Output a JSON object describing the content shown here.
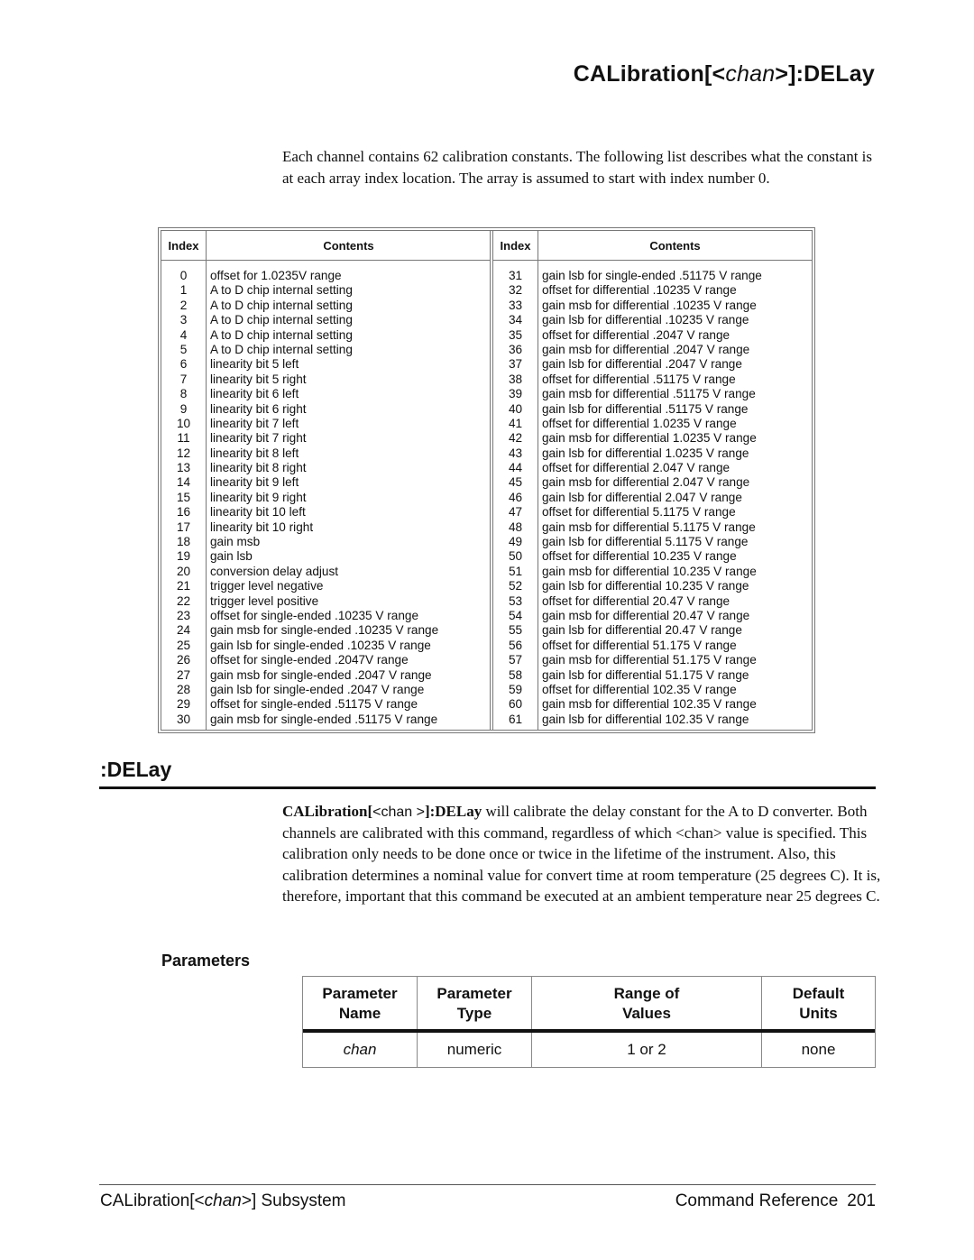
{
  "header": {
    "title_prefix": "CALibration[<",
    "title_italic": "chan",
    "title_suffix": ">]:DELay"
  },
  "intro": "Each channel contains 62 calibration constants.  The following list describes what the constant is at each array index location.  The array is assumed to start with index number 0.",
  "cal_table": {
    "headers": {
      "index": "Index",
      "contents": "Contents"
    },
    "left": [
      {
        "i": "0",
        "c": "offset for 1.0235V range"
      },
      {
        "i": "1",
        "c": "A to D chip internal setting"
      },
      {
        "i": "2",
        "c": "A to D chip internal setting"
      },
      {
        "i": "3",
        "c": "A to D chip internal setting"
      },
      {
        "i": "4",
        "c": "A to D chip internal setting"
      },
      {
        "i": "5",
        "c": "A to D chip internal setting"
      },
      {
        "i": "6",
        "c": "linearity bit 5 left"
      },
      {
        "i": "7",
        "c": "linearity bit 5 right"
      },
      {
        "i": "8",
        "c": "linearity bit 6 left"
      },
      {
        "i": "9",
        "c": "linearity bit 6 right"
      },
      {
        "i": "10",
        "c": "linearity bit 7 left"
      },
      {
        "i": "11",
        "c": "linearity bit 7 right"
      },
      {
        "i": "12",
        "c": "linearity bit 8 left"
      },
      {
        "i": "13",
        "c": "linearity bit 8 right"
      },
      {
        "i": "14",
        "c": "linearity bit 9 left"
      },
      {
        "i": "15",
        "c": "linearity bit 9 right"
      },
      {
        "i": "16",
        "c": "linearity bit 10 left"
      },
      {
        "i": "17",
        "c": "linearity bit 10 right"
      },
      {
        "i": "18",
        "c": "gain msb"
      },
      {
        "i": "19",
        "c": "gain lsb"
      },
      {
        "i": "20",
        "c": "conversion delay adjust"
      },
      {
        "i": "21",
        "c": "trigger level negative"
      },
      {
        "i": "22",
        "c": "trigger level positive"
      },
      {
        "i": "23",
        "c": "offset for single-ended .10235 V range"
      },
      {
        "i": "24",
        "c": "gain msb for single-ended .10235 V range"
      },
      {
        "i": "25",
        "c": "gain lsb for single-ended .10235 V range"
      },
      {
        "i": "26",
        "c": "offset for single-ended .2047V range"
      },
      {
        "i": "27",
        "c": "gain msb for single-ended .2047 V range"
      },
      {
        "i": "28",
        "c": "gain lsb for single-ended .2047 V range"
      },
      {
        "i": "29",
        "c": "offset for single-ended .51175 V range"
      },
      {
        "i": "30",
        "c": "gain msb for single-ended .51175 V range"
      }
    ],
    "right": [
      {
        "i": "31",
        "c": "gain lsb for single-ended .51175 V range"
      },
      {
        "i": "32",
        "c": "offset for differential .10235 V range"
      },
      {
        "i": "33",
        "c": "gain msb for differential .10235 V range"
      },
      {
        "i": "34",
        "c": "gain lsb for differential .10235 V range"
      },
      {
        "i": "35",
        "c": "offset for differential .2047 V range"
      },
      {
        "i": "36",
        "c": "gain msb for differential .2047 V range"
      },
      {
        "i": "37",
        "c": "gain lsb for differential .2047 V range"
      },
      {
        "i": "38",
        "c": "offset for differential .51175 V range"
      },
      {
        "i": "39",
        "c": "gain msb for differential .51175 V range"
      },
      {
        "i": "40",
        "c": "gain lsb for differential .51175 V range"
      },
      {
        "i": "41",
        "c": "offset for differential 1.0235 V range"
      },
      {
        "i": "42",
        "c": "gain msb for differential 1.0235 V range"
      },
      {
        "i": "43",
        "c": "gain lsb for differential 1.0235 V range"
      },
      {
        "i": "44",
        "c": "offset for differential 2.047 V range"
      },
      {
        "i": "45",
        "c": "gain msb for differential 2.047 V range"
      },
      {
        "i": "46",
        "c": "gain lsb for differential 2.047 V range"
      },
      {
        "i": "47",
        "c": "offset for differential 5.1175 V range"
      },
      {
        "i": "48",
        "c": "gain msb for differential 5.1175 V range"
      },
      {
        "i": "49",
        "c": "gain lsb for differential 5.1175 V range"
      },
      {
        "i": "50",
        "c": "offset for differential 10.235 V range"
      },
      {
        "i": "51",
        "c": "gain msb for differential 10.235 V range"
      },
      {
        "i": "52",
        "c": "gain lsb for differential 10.235 V range"
      },
      {
        "i": "53",
        "c": "offset for differential 20.47 V range"
      },
      {
        "i": "54",
        "c": "gain msb for differential 20.47 V range"
      },
      {
        "i": "55",
        "c": "gain lsb for differential 20.47 V range"
      },
      {
        "i": "56",
        "c": "offset for differential 51.175 V range"
      },
      {
        "i": "57",
        "c": "gain msb for differential 51.175 V range"
      },
      {
        "i": "58",
        "c": "gain lsb for differential 51.175 V range"
      },
      {
        "i": "59",
        "c": "offset for differential 102.35 V range"
      },
      {
        "i": "60",
        "c": "gain msb for differential 102.35 V range"
      },
      {
        "i": "61",
        "c": "gain lsb for differential 102.35 V range"
      }
    ]
  },
  "delay_section": {
    "title": ":DELay",
    "cmd_bold_1": "CALibration[",
    "cmd_sans": "<chan >",
    "cmd_bold_2": "]:DELay",
    "description": " will calibrate the delay constant for the A to D converter.  Both channels are calibrated with this command, regardless of which <chan> value is specified.  This calibration only needs to be done once or twice in the lifetime of the instrument.  Also, this calibration determines a nominal value for convert time at room temperature (25 degrees C).  It is, therefore, important that this command be executed at an ambient temperature near 25 degrees C."
  },
  "parameters": {
    "title": "Parameters",
    "headers": [
      [
        "Parameter",
        "Name"
      ],
      [
        "Parameter",
        "Type"
      ],
      [
        "Range of",
        "Values"
      ],
      [
        "Default",
        "Units"
      ]
    ],
    "row": [
      "chan",
      "numeric",
      "1 or 2",
      "none"
    ]
  },
  "footer": {
    "left_prefix": "CALibration[<",
    "left_italic": "chan",
    "left_suffix": ">] Subsystem",
    "right_label": "Command Reference",
    "page_number": "201"
  }
}
